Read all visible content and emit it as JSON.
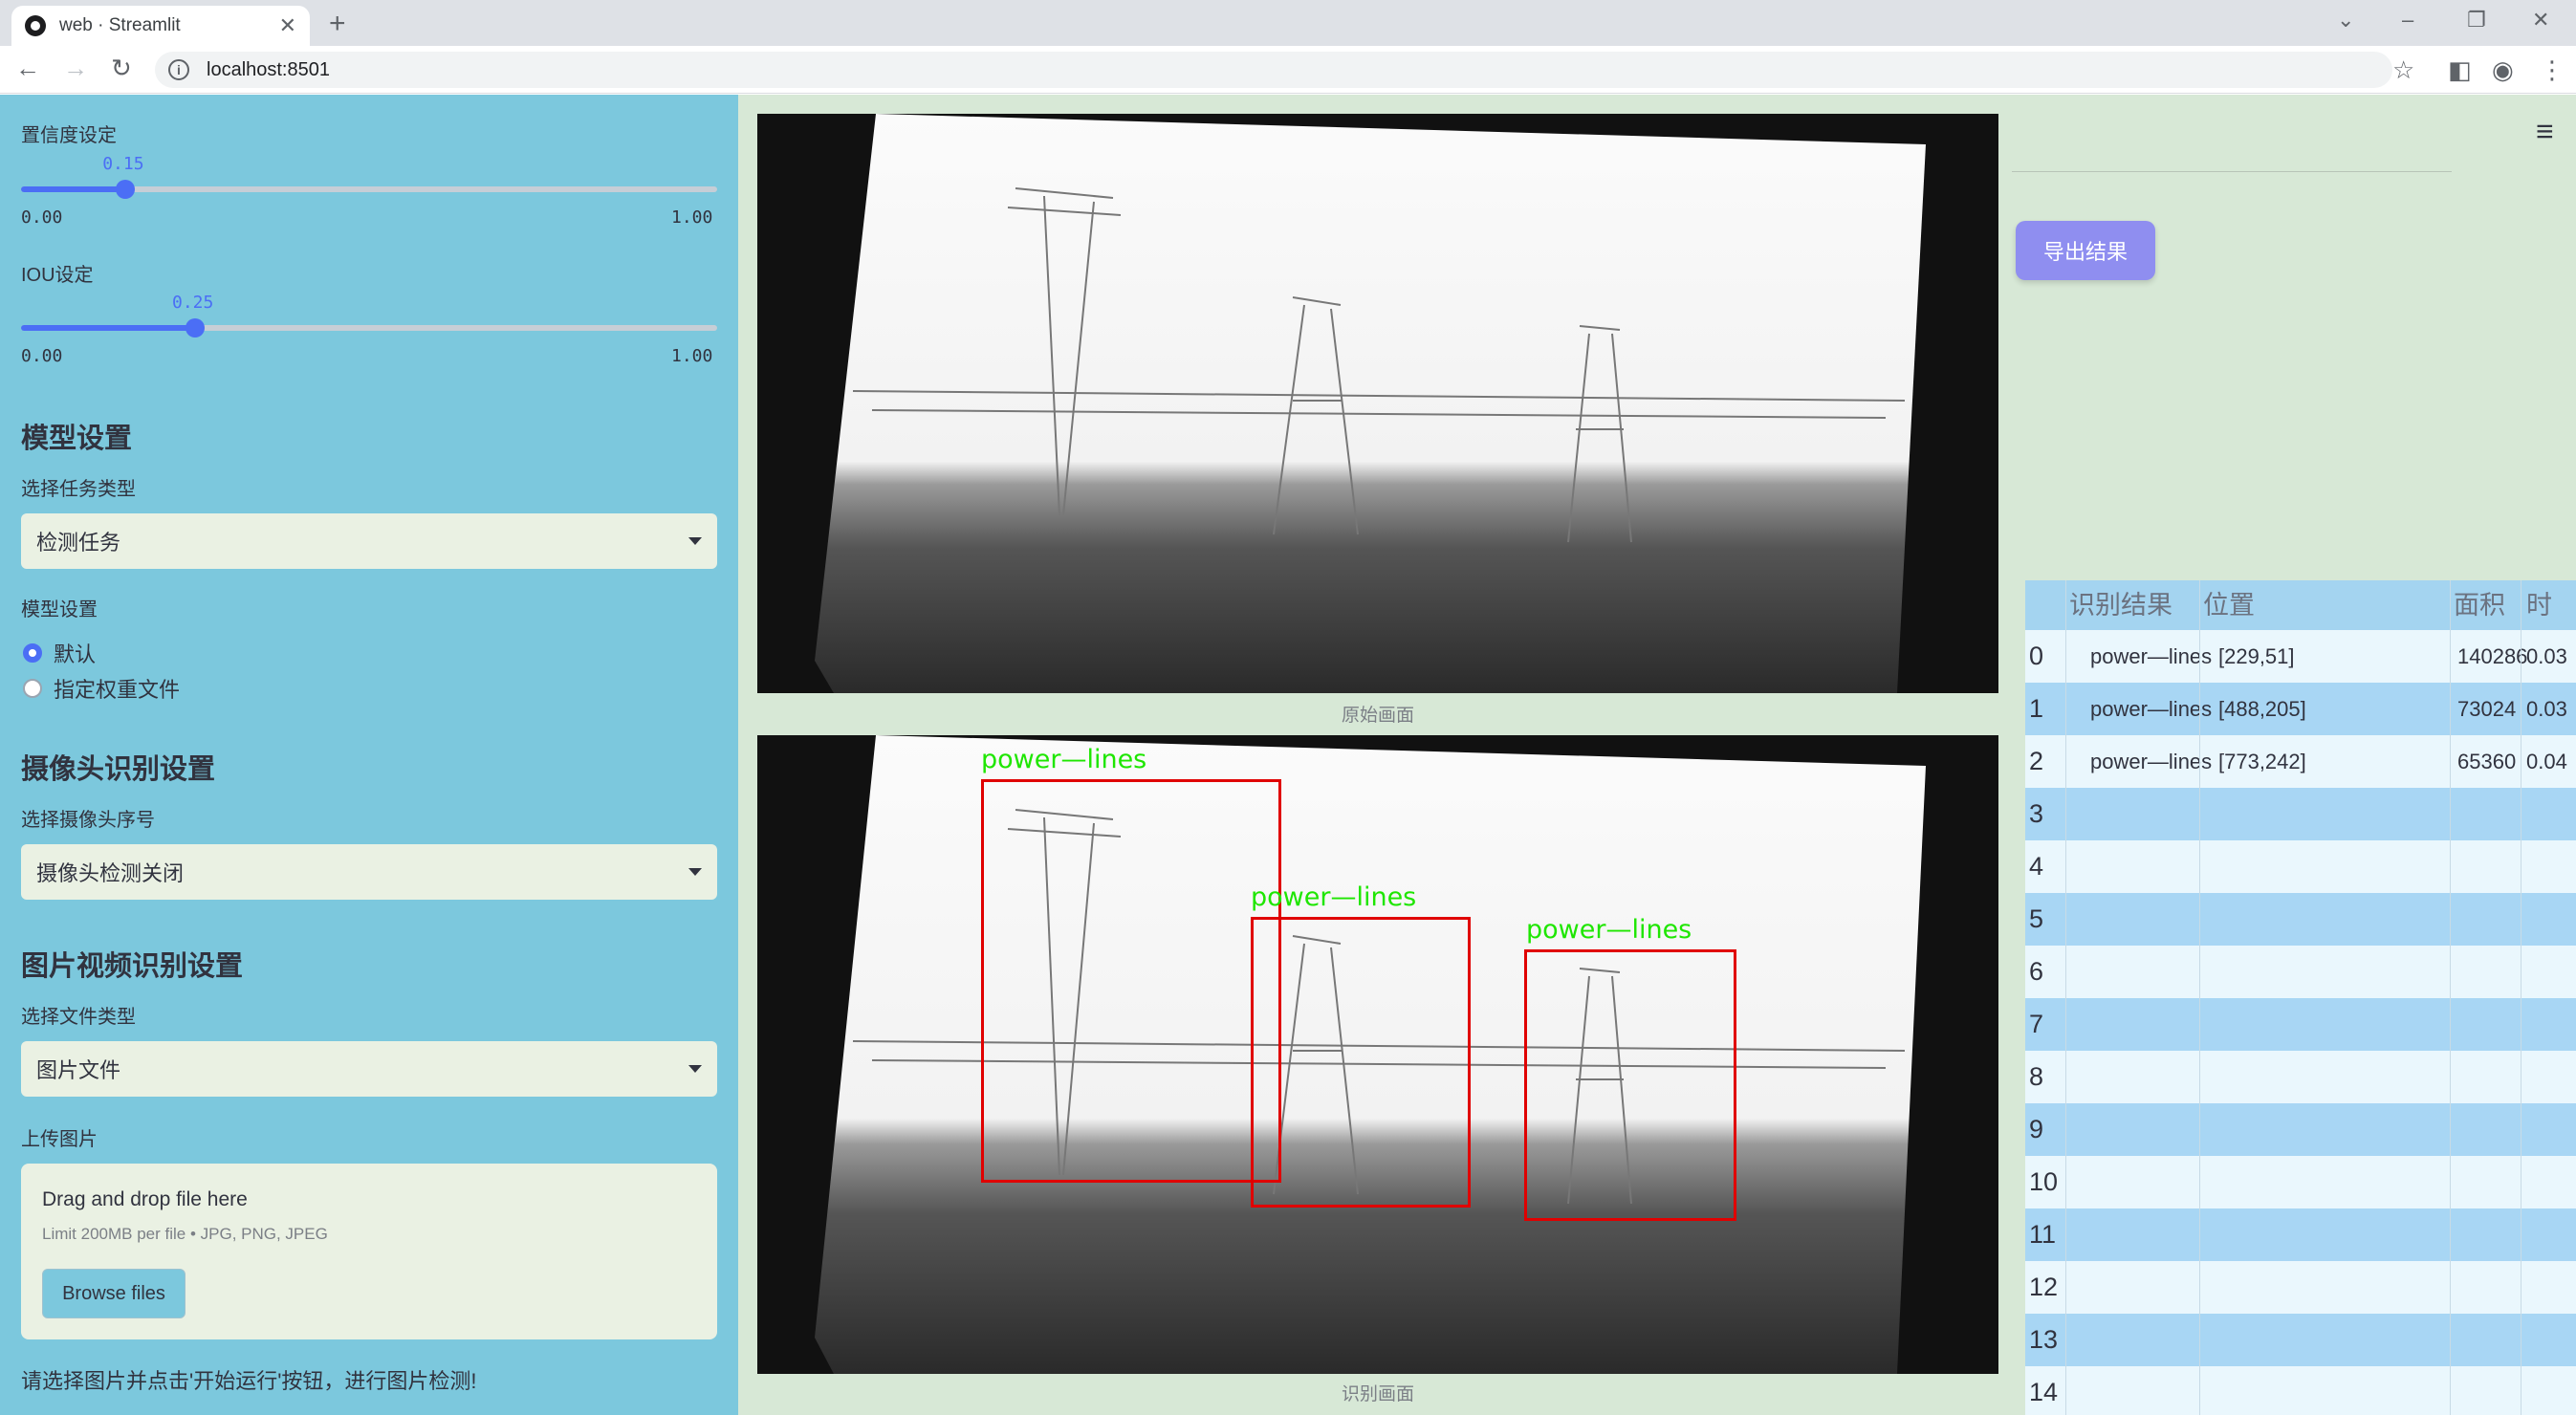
{
  "browser": {
    "tab_title": "web · Streamlit",
    "url": "localhost:8501",
    "new_tab": "+",
    "close": "✕"
  },
  "sidebar": {
    "confidence": {
      "label": "置信度设定",
      "value": "0.15",
      "min": "0.00",
      "max": "1.00",
      "fraction": 0.15
    },
    "iou": {
      "label": "IOU设定",
      "value": "0.25",
      "min": "0.00",
      "max": "1.00",
      "fraction": 0.25
    },
    "model_section": "模型设置",
    "task_label": "选择任务类型",
    "task_value": "检测任务",
    "model_label": "模型设置",
    "model_options": [
      "默认",
      "指定权重文件"
    ],
    "model_selected": 0,
    "camera_section": "摄像头识别设置",
    "camera_label": "选择摄像头序号",
    "camera_value": "摄像头检测关闭",
    "media_section": "图片视频识别设置",
    "filetype_label": "选择文件类型",
    "filetype_value": "图片文件",
    "upload_label": "上传图片",
    "upload": {
      "title": "Drag and drop file here",
      "limit": "Limit 200MB per file • JPG, PNG, JPEG",
      "button": "Browse files"
    },
    "footer": "请选择图片并点击'开始运行'按钮，进行图片检测!"
  },
  "main": {
    "orig_caption": "原始画面",
    "det_caption": "识别画面",
    "detections": [
      {
        "label": "power—lines"
      },
      {
        "label": "power—lines"
      },
      {
        "label": "power—lines"
      }
    ],
    "export_button": "导出结果",
    "table": {
      "headers": [
        "识别结果",
        "位置",
        "面积",
        "时间"
      ],
      "rows": [
        {
          "idx": "0",
          "result": "power—lines",
          "pos": "[229,51]",
          "area": "140286",
          "time": "0.03"
        },
        {
          "idx": "1",
          "result": "power—lines",
          "pos": "[488,205]",
          "area": "73024",
          "time": "0.03"
        },
        {
          "idx": "2",
          "result": "power—lines",
          "pos": "[773,242]",
          "area": "65360",
          "time": "0.04"
        },
        {
          "idx": "3",
          "result": "",
          "pos": "",
          "area": "",
          "time": ""
        },
        {
          "idx": "4",
          "result": "",
          "pos": "",
          "area": "",
          "time": ""
        },
        {
          "idx": "5",
          "result": "",
          "pos": "",
          "area": "",
          "time": ""
        },
        {
          "idx": "6",
          "result": "",
          "pos": "",
          "area": "",
          "time": ""
        },
        {
          "idx": "7",
          "result": "",
          "pos": "",
          "area": "",
          "time": ""
        },
        {
          "idx": "8",
          "result": "",
          "pos": "",
          "area": "",
          "time": ""
        },
        {
          "idx": "9",
          "result": "",
          "pos": "",
          "area": "",
          "time": ""
        },
        {
          "idx": "10",
          "result": "",
          "pos": "",
          "area": "",
          "time": ""
        },
        {
          "idx": "11",
          "result": "",
          "pos": "",
          "area": "",
          "time": ""
        },
        {
          "idx": "12",
          "result": "",
          "pos": "",
          "area": "",
          "time": ""
        },
        {
          "idx": "13",
          "result": "",
          "pos": "",
          "area": "",
          "time": ""
        },
        {
          "idx": "14",
          "result": "",
          "pos": "",
          "area": "",
          "time": ""
        }
      ]
    }
  },
  "colors": {
    "sidebar_bg": "#7cc8dd",
    "main_bg": "#d7e8d6",
    "accent": "#4b6ef5",
    "export_btn": "#8f8ef0",
    "box_red": "#e00000",
    "label_green": "#1ee600"
  }
}
